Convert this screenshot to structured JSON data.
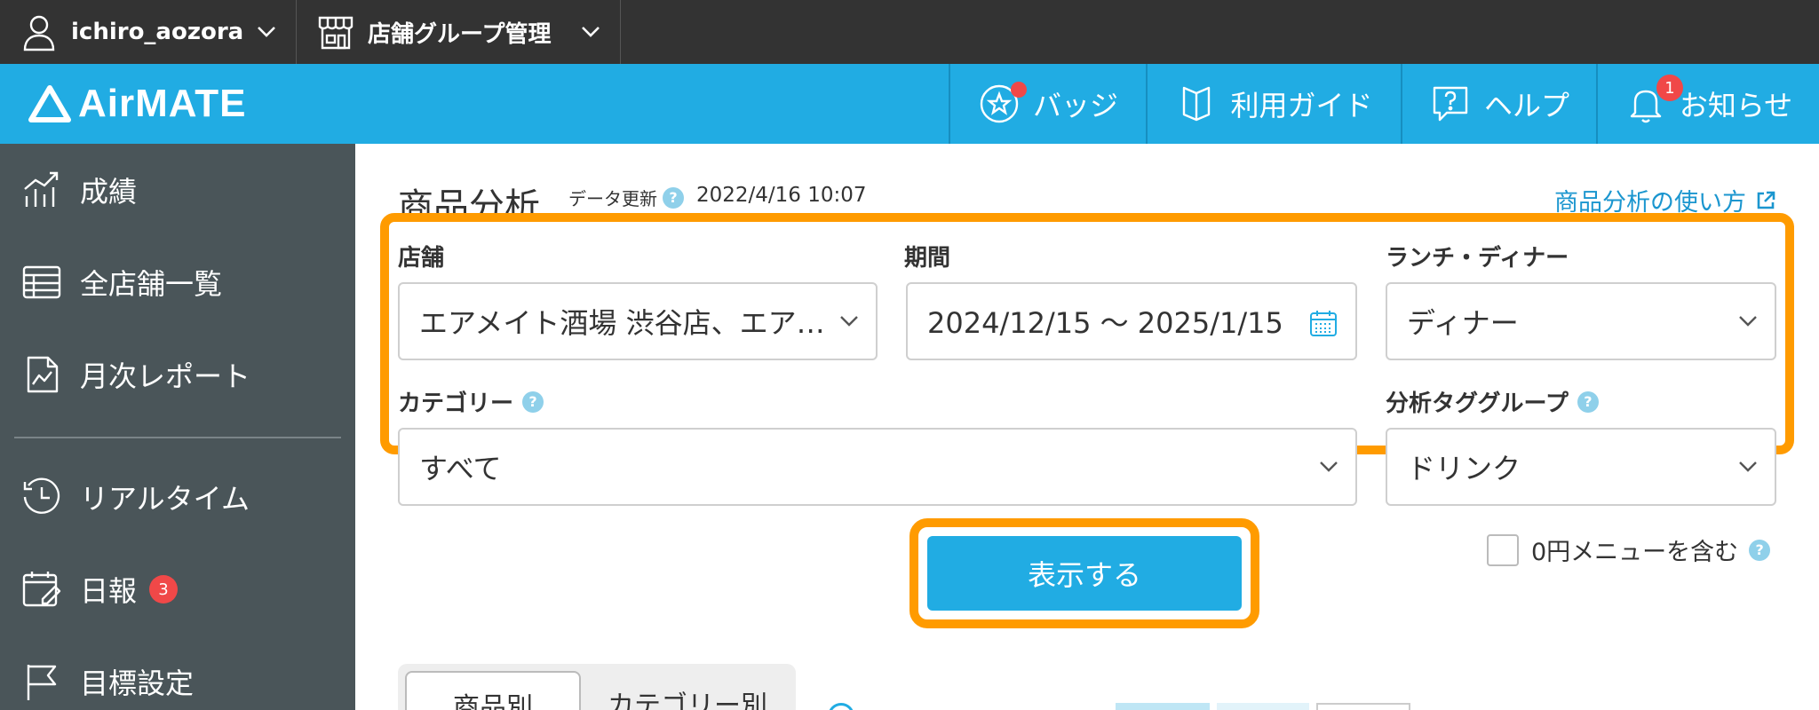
{
  "topbar": {
    "user_name": "ichiro_aozora",
    "group_label": "店舗グループ管理"
  },
  "header": {
    "logo_text": "AirMATE",
    "nav": [
      {
        "label": "バッジ",
        "icon": "badge-star-icon"
      },
      {
        "label": "利用ガイド",
        "icon": "book-icon"
      },
      {
        "label": "ヘルプ",
        "icon": "help-bubble-icon"
      },
      {
        "label": "お知らせ",
        "icon": "bell-icon",
        "count": "1"
      }
    ]
  },
  "sidebar": {
    "items": [
      {
        "label": "成績",
        "icon": "chart-icon"
      },
      {
        "label": "全店舗一覧",
        "icon": "table-icon"
      },
      {
        "label": "月次レポート",
        "icon": "report-icon"
      },
      {
        "label": "リアルタイム",
        "icon": "clock-icon"
      },
      {
        "label": "日報",
        "icon": "calendar-edit-icon",
        "badge": "3"
      },
      {
        "label": "目標設定",
        "icon": "flag-icon"
      }
    ]
  },
  "main": {
    "title": "商品分析",
    "update_label": "データ更新",
    "update_time": "2022/4/16 10:07",
    "howto_link": "商品分析の使い方",
    "fields": {
      "store_label": "店舗",
      "store_value": "エアメイト酒場 渋谷店、エア…",
      "period_label": "期間",
      "period_value": "2024/12/15 〜 2025/1/15",
      "meal_label": "ランチ・ディナー",
      "meal_value": "ディナー",
      "category_label": "カテゴリー",
      "category_value": "すべて",
      "tag_label": "分析タググループ",
      "tag_value": "ドリンク"
    },
    "show_button": "表示する",
    "zero_yen_label": "0円メニューを含む",
    "tabs": [
      "商品別",
      "カテゴリー別"
    ]
  },
  "colors": {
    "topbar": "#333333",
    "header": "#21ace3",
    "sidebar": "#4a5559",
    "highlight": "#ff9b00",
    "badge": "#f04848"
  }
}
